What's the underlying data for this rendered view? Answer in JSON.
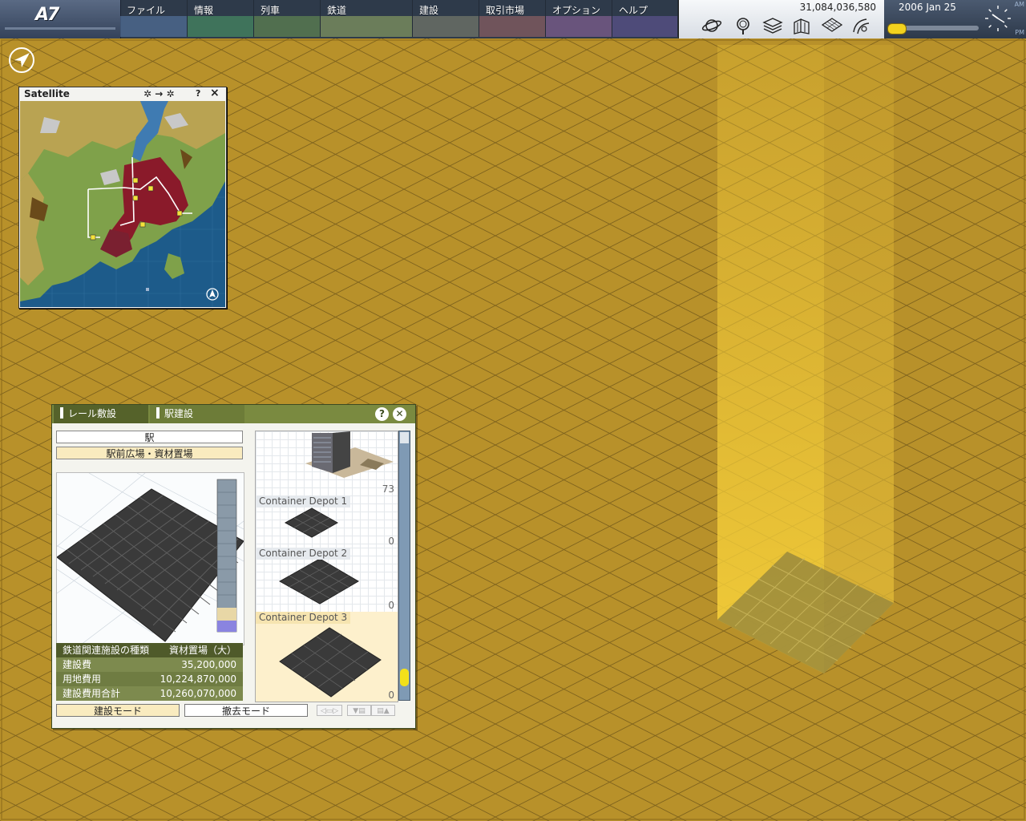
{
  "menubar": {
    "logo_text": "A7",
    "items": [
      {
        "label": "ファイル",
        "color": "#5d7fb0"
      },
      {
        "label": "情報",
        "color": "#4fa36a"
      },
      {
        "label": "列車",
        "color": "#6f9a54"
      },
      {
        "label": "鉄道",
        "color": "#9fb468"
      },
      {
        "label": "建設",
        "color": "#8a8a74"
      },
      {
        "label": "取引市場",
        "color": "#a86a6a"
      },
      {
        "label": "オプション",
        "color": "#9a6aa6"
      },
      {
        "label": "ヘルプ",
        "color": "#6a5aa0"
      }
    ]
  },
  "toolbar": {
    "money": "31,084,036,580",
    "icons": [
      "planet-icon",
      "magnifier-icon",
      "layers-icon",
      "buildings-icon",
      "terrain-grid-icon",
      "rail-icon"
    ]
  },
  "datepanel": {
    "date": "2006  Jan  25",
    "am": "AM",
    "pm": "PM"
  },
  "satellite": {
    "title": "Satellite",
    "rotate_label": "✲ → ✲",
    "help": "?",
    "close": "×"
  },
  "railwin": {
    "tabs": [
      "レール敷設",
      "駅建設"
    ],
    "help": "?",
    "close": "✕",
    "category": "駅",
    "subcategory": "駅前広場・資材置場",
    "info": [
      {
        "label": "鉄道関連施設の種類",
        "value": "資材置場（大）"
      },
      {
        "label": "建設費",
        "value": "35,200,000"
      },
      {
        "label": "用地費用",
        "value": "10,224,870,000"
      },
      {
        "label": "建設費用合計",
        "value": "10,260,070,000"
      }
    ],
    "build_mode": "建設モード",
    "remove_mode": "撤去モード",
    "list": [
      {
        "label": "",
        "count": "73"
      },
      {
        "label": "Container Depot 1",
        "count": "0"
      },
      {
        "label": "Container Depot 2",
        "count": "0"
      },
      {
        "label": "Container Depot 3",
        "count": "0"
      }
    ]
  }
}
